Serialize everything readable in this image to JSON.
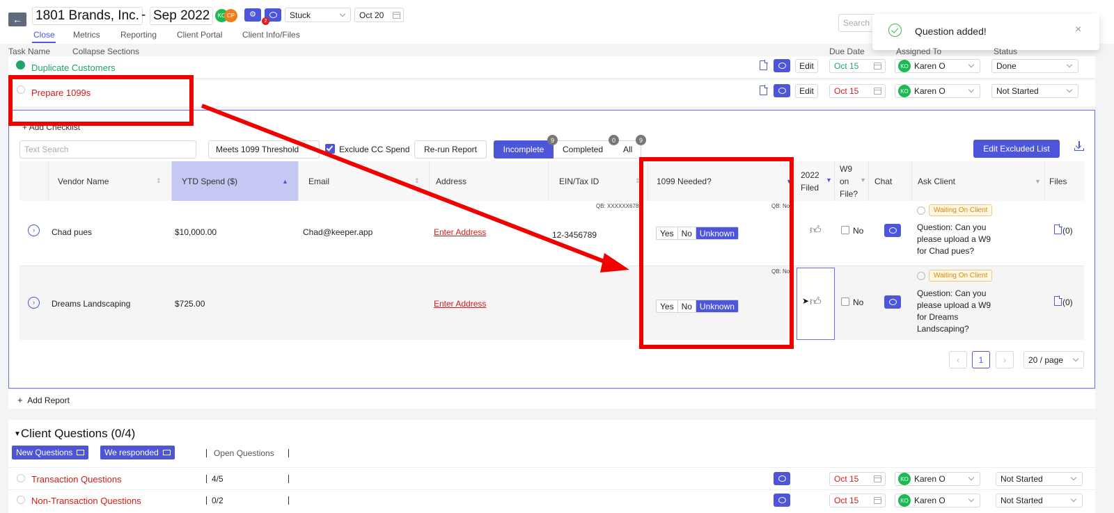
{
  "header": {
    "company": "1801 Brands, Inc.",
    "dash": "-",
    "period": "Sep 2022",
    "avatars": [
      "KO",
      "CP"
    ],
    "notify_count": "2",
    "status": "Stuck",
    "date": "Oct 20",
    "search_placeholder": "Search"
  },
  "tabs": [
    "Close",
    "Metrics",
    "Reporting",
    "Client Portal",
    "Client Info/Files"
  ],
  "toast": {
    "message": "Question added!"
  },
  "toolbar": {
    "task_name": "Task Name",
    "collapse": "Collapse Sections"
  },
  "columns": {
    "due": "Due Date",
    "assigned": "Assigned To",
    "status": "Status"
  },
  "tasks": [
    {
      "name": "Duplicate Customers",
      "edit": "Edit",
      "due": "Oct 15",
      "assignee": "Karen O",
      "initials": "KO",
      "status": "Done"
    },
    {
      "name": "Prepare 1099s",
      "edit": "Edit",
      "due": "Oct 15",
      "assignee": "Karen O",
      "initials": "KO",
      "status": "Not Started"
    }
  ],
  "checklist": {
    "add_checklist": "Add Checklist",
    "search_placeholder": "Text Search",
    "threshold": "Meets 1099 Threshold",
    "exclude_cc": "Exclude CC Spend",
    "rerun": "Re-run Report",
    "filters": [
      {
        "label": "Incomplete",
        "count": "9"
      },
      {
        "label": "Completed",
        "count": "0"
      },
      {
        "label": "All",
        "count": "9"
      }
    ],
    "edit_excluded": "Edit Excluded List"
  },
  "table": {
    "headers": {
      "vendor": "Vendor Name",
      "ytd": "YTD Spend ($)",
      "email": "Email",
      "address": "Address",
      "ein": "EIN/Tax ID",
      "needed": "1099 Needed?",
      "filed_1": "2022",
      "filed_2": "Filed",
      "w9_1": "W9",
      "w9_2": "on",
      "w9_3": "File?",
      "chat": "Chat",
      "ask": "Ask Client",
      "files": "Files"
    },
    "qb_label": "QB: XXXXXX6789",
    "qb_short": "QB: No",
    "seg_options": [
      "Yes",
      "No",
      "Unknown"
    ],
    "rows": [
      {
        "vendor": "Chad pues",
        "ytd": "$10,000.00",
        "email": "Chad@keeper.app",
        "address": "Enter Address",
        "ein": "12-3456789",
        "w9": "No",
        "waiting": "Waiting On Client",
        "question": [
          "Question: Can you",
          "please upload a W9",
          "for Chad pues?"
        ],
        "files": "(0)"
      },
      {
        "vendor": "Dreams Landscaping",
        "ytd": "$725.00",
        "email": "",
        "address": "Enter Address",
        "ein": "",
        "w9": "No",
        "waiting": "Waiting On Client",
        "question": [
          "Question: Can you",
          "please upload a W9",
          "for Dreams",
          "Landscaping?"
        ],
        "files": "(0)"
      }
    ],
    "pagination": {
      "page": "1",
      "per_page": "20 / page"
    }
  },
  "add_report": "Add Report",
  "client_questions": {
    "title": "Client Questions (0/4)",
    "new_questions": "New Questions",
    "we_responded": "We responded",
    "open_questions": "Open Questions",
    "rows": [
      {
        "name": "Transaction Questions",
        "count": "4/5",
        "due": "Oct 15",
        "assignee": "Karen O",
        "initials": "KO",
        "status": "Not Started"
      },
      {
        "name": "Non-Transaction Questions",
        "count": "0/2",
        "due": "Oct 15",
        "assignee": "Karen O",
        "initials": "KO",
        "status": "Not Started"
      }
    ]
  }
}
